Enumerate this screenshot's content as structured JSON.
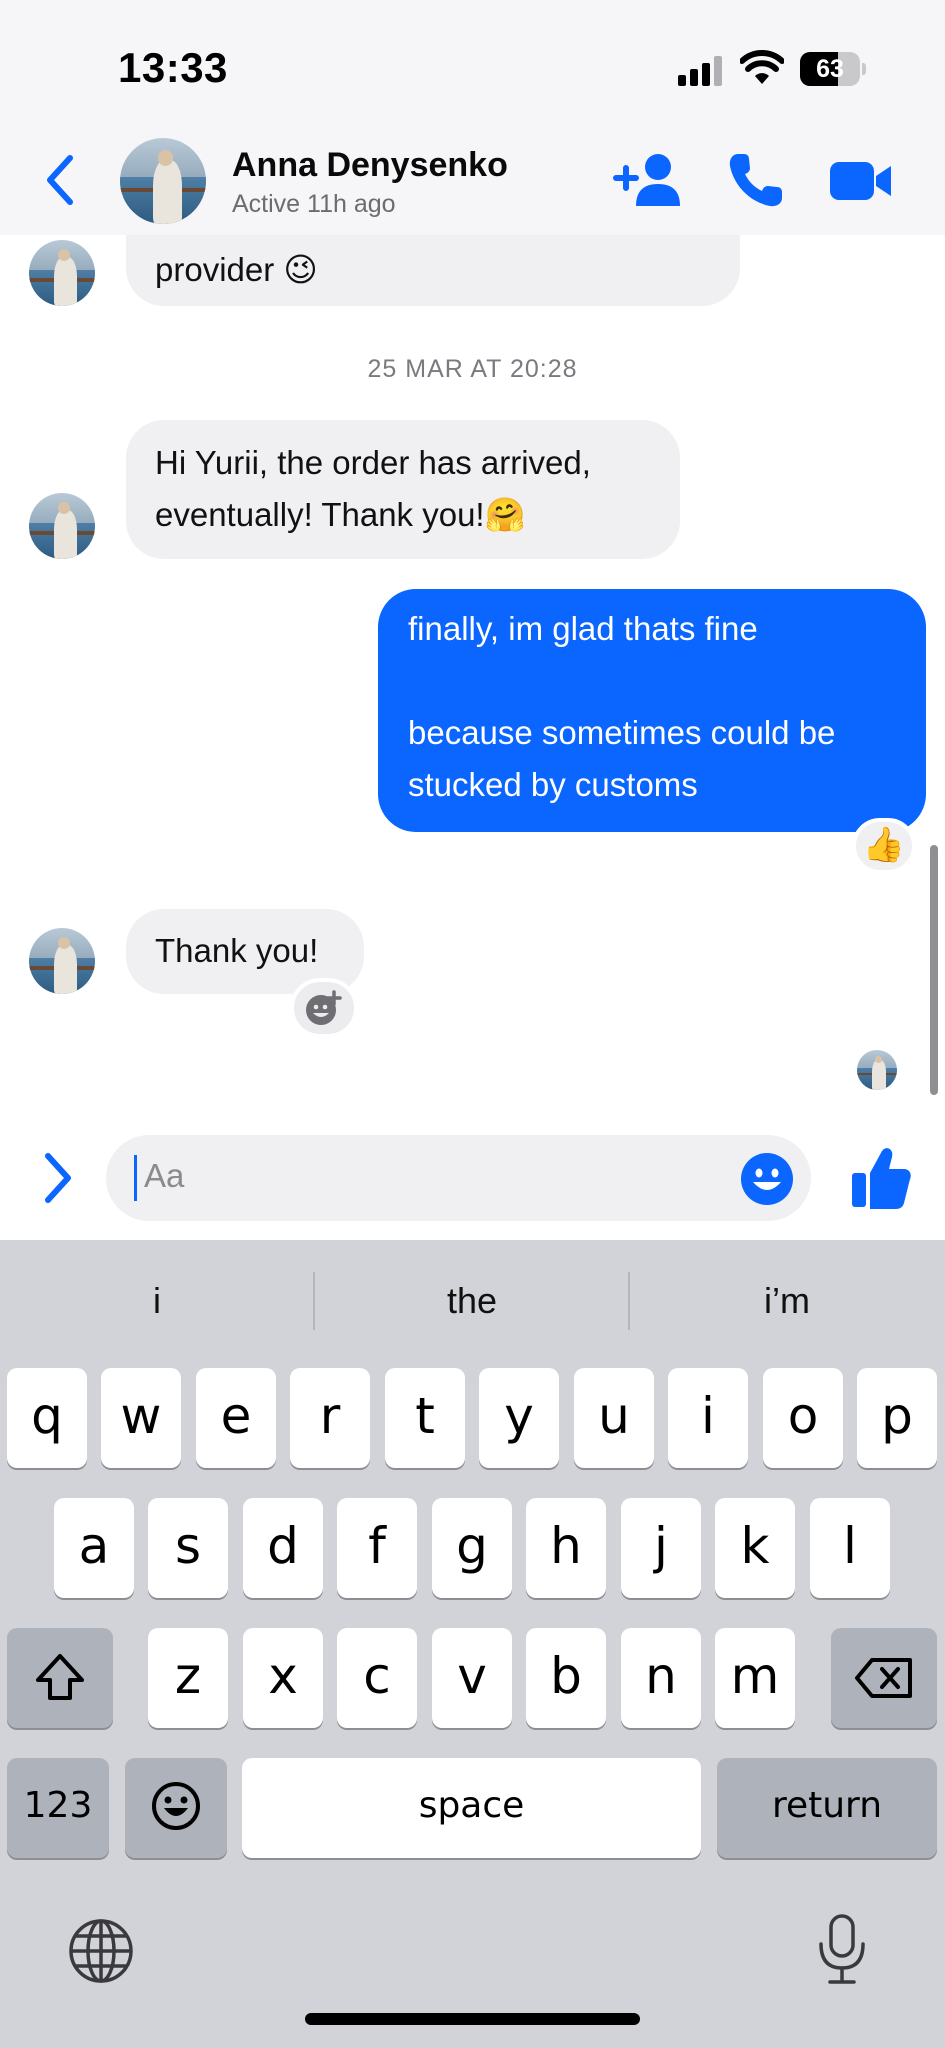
{
  "status_bar": {
    "time": "13:33",
    "battery": "63",
    "battery_level": 0.63
  },
  "header": {
    "name": "Anna Denysenko",
    "status": "Active 11h ago",
    "icons": [
      "chevron-left-icon",
      "add-person-icon",
      "phone-icon",
      "video-camera-icon"
    ]
  },
  "chat": {
    "partial_message": "provider 😉",
    "timestamp": "25 MAR AT 20:28",
    "msg1_line1": "Hi Yurii, the order has arrived,",
    "msg1_line2": "eventually! Thank you!🤗",
    "out_line1": "finally, im glad thats fine",
    "out_line2": "because sometimes could be",
    "out_line3": "stucked by customs",
    "out_reaction": "👍",
    "msg2": "Thank you!"
  },
  "composer": {
    "placeholder": "Aa"
  },
  "keyboard": {
    "suggestions": [
      "i",
      "the",
      "i’m"
    ],
    "row1": [
      "q",
      "w",
      "e",
      "r",
      "t",
      "y",
      "u",
      "i",
      "o",
      "p"
    ],
    "row2": [
      "a",
      "s",
      "d",
      "f",
      "g",
      "h",
      "j",
      "k",
      "l"
    ],
    "row3": [
      "z",
      "x",
      "c",
      "v",
      "b",
      "n",
      "m"
    ],
    "numbers_key": "123",
    "space_key": "space",
    "return_key": "return"
  },
  "colors": {
    "accent": "#0a66ff",
    "incoming_bubble": "#f0f0f2",
    "keyboard_bg": "#d1d3d9"
  }
}
